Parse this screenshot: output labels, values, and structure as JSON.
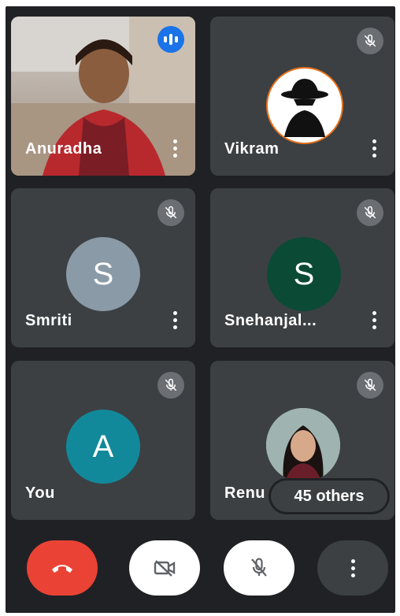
{
  "participants": [
    {
      "name": "Anuradha",
      "type": "video",
      "status": "speaking"
    },
    {
      "name": "Vikram",
      "type": "avatar-image",
      "status": "muted"
    },
    {
      "name": "Smriti",
      "type": "initial",
      "initial": "S",
      "color": "#8a9aa6",
      "status": "muted"
    },
    {
      "name": "Snehanjal...",
      "type": "initial",
      "initial": "S",
      "color": "#0b4a34",
      "status": "muted"
    },
    {
      "name": "You",
      "type": "initial",
      "initial": "A",
      "color": "#12899a",
      "status": "muted"
    },
    {
      "name": "Renu",
      "type": "avatar-image",
      "status": "muted"
    }
  ],
  "others_label": "45 others",
  "controls": [
    {
      "icon": "end-call-icon",
      "color": "#ea4335"
    },
    {
      "icon": "camera-off-icon",
      "color": "#ffffff"
    },
    {
      "icon": "mic-off-icon",
      "color": "#ffffff"
    },
    {
      "icon": "more-vert-icon",
      "color": "#3c4043"
    }
  ]
}
